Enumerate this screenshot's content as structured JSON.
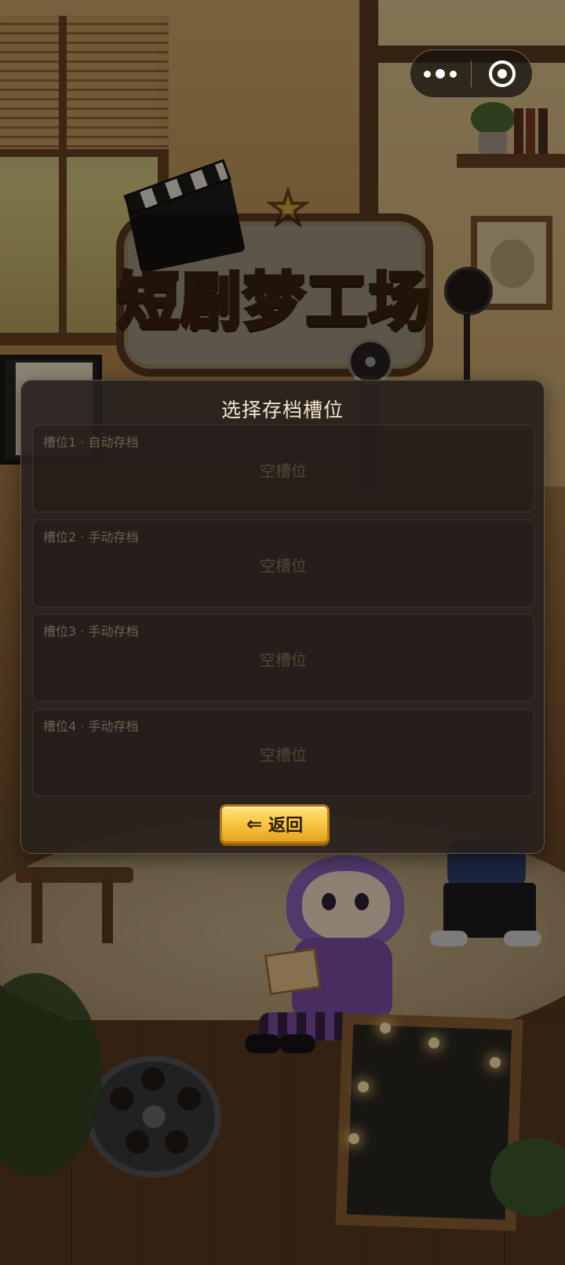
{
  "app": {
    "logo_title": "短剧梦工场"
  },
  "menu_capsule": {
    "more_icon": "more-dots-icon",
    "close_icon": "target-close-icon"
  },
  "dialog": {
    "title": "选择存档槽位",
    "slots": [
      {
        "label": "槽位1 · 自动存档",
        "status": "空槽位"
      },
      {
        "label": "槽位2 · 手动存档",
        "status": "空槽位"
      },
      {
        "label": "槽位3 · 手动存档",
        "status": "空槽位"
      },
      {
        "label": "槽位4 · 手动存档",
        "status": "空槽位"
      }
    ],
    "back_button": {
      "icon": "arrow-left-icon",
      "arrow_glyph": "⇐",
      "label": "返回"
    }
  },
  "colors": {
    "dialog_bg": "#28211e",
    "title_text": "#f3e6cb",
    "button_gold": "#f6c23c",
    "slot_text": "#6f6152"
  }
}
